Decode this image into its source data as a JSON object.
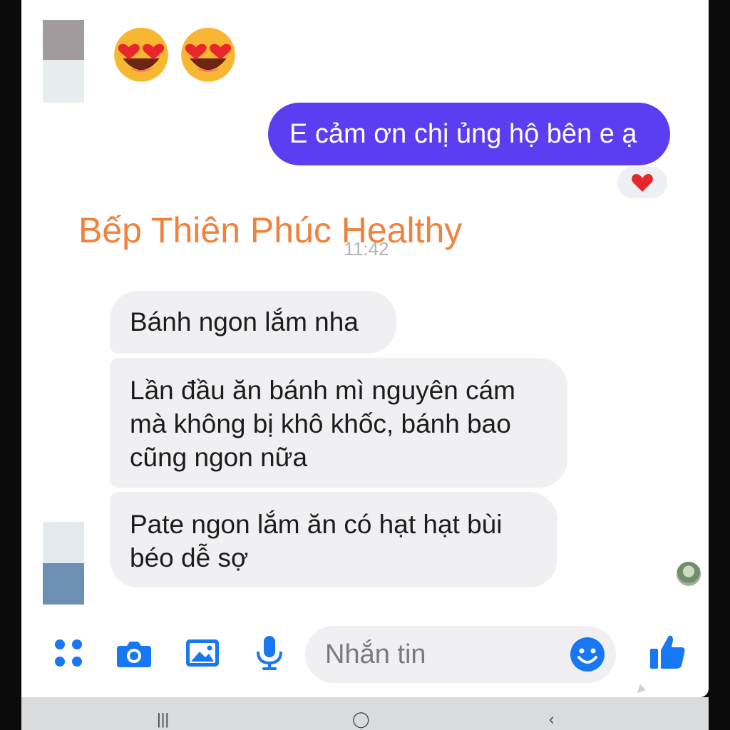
{
  "conversation": {
    "sent_message": "E cảm ơn chị ủng hộ bên e ạ",
    "timestamp": "11:42",
    "received_messages": [
      {
        "lines": [
          "Bánh ngon lắm nha"
        ]
      },
      {
        "lines": [
          "Lần đầu ăn bánh mì nguyên cám",
          "mà không bị khô khốc, bánh bao",
          "cũng ngon nữa"
        ]
      },
      {
        "lines": [
          "Pate ngon lắm ăn có hạt hạt bùi",
          "béo dễ sợ"
        ]
      }
    ],
    "emojis": [
      "heart-eyes-emoji",
      "heart-eyes-emoji"
    ],
    "reaction_icon": "heart-icon"
  },
  "watermark": "Bếp Thiên Phúc Healthy",
  "composer": {
    "placeholder": "Nhắn tin",
    "icons": [
      "apps-icon",
      "camera-icon",
      "gallery-icon",
      "mic-icon",
      "smile-icon",
      "thumbs-up-icon"
    ]
  },
  "colors": {
    "sent_bubble": "#5b3ef2",
    "received_bubble": "#f0f0f2",
    "accent": "#1877f2",
    "watermark": "#f0823c"
  }
}
